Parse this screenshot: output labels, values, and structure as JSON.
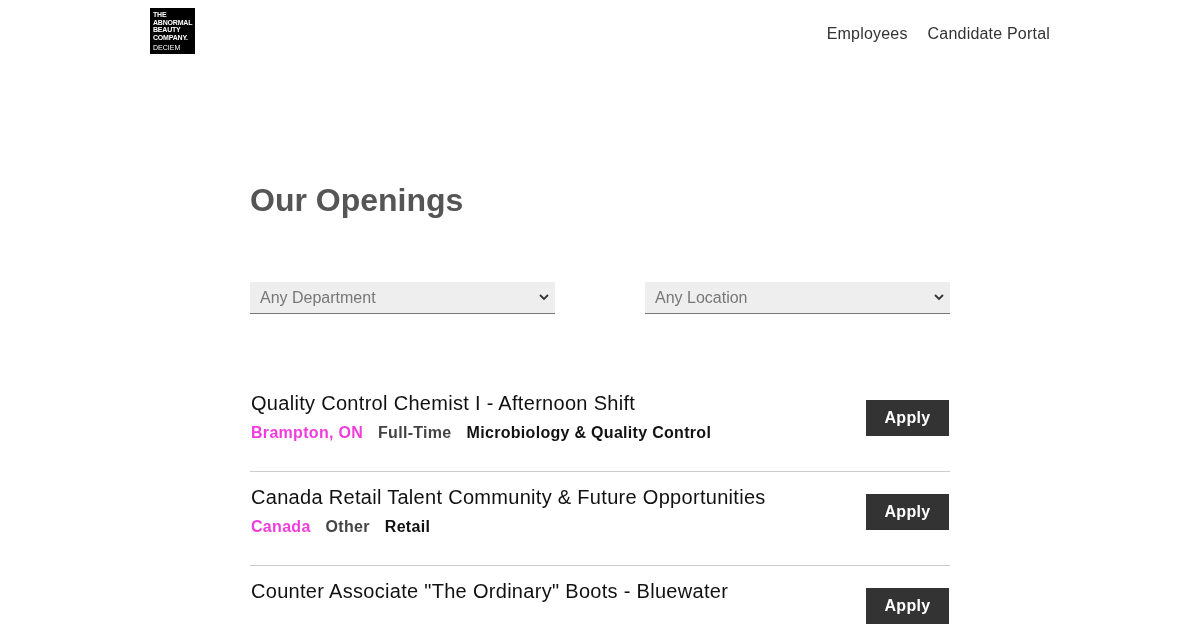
{
  "logo": {
    "lines": [
      "THE",
      "ABNORMAL",
      "BEAUTY",
      "COMPANY."
    ],
    "sub": "DECIEM"
  },
  "nav": [
    "Employees",
    "Candidate Portal"
  ],
  "heading": "Our Openings",
  "filters": [
    {
      "placeholder": "Any Department"
    },
    {
      "placeholder": "Any Location"
    }
  ],
  "jobs": [
    {
      "title": "Quality Control Chemist I - Afternoon Shift",
      "location": "Brampton, ON",
      "type": "Full-Time",
      "department": "Microbiology & Quality Control",
      "button": "Apply"
    },
    {
      "title": "Canada Retail Talent Community & Future Opportunities",
      "location": "Canada",
      "type": "Other",
      "department": "Retail",
      "button": "Apply"
    },
    {
      "title": "Counter Associate \"The Ordinary\" Boots - Bluewater",
      "button": "Apply"
    }
  ]
}
